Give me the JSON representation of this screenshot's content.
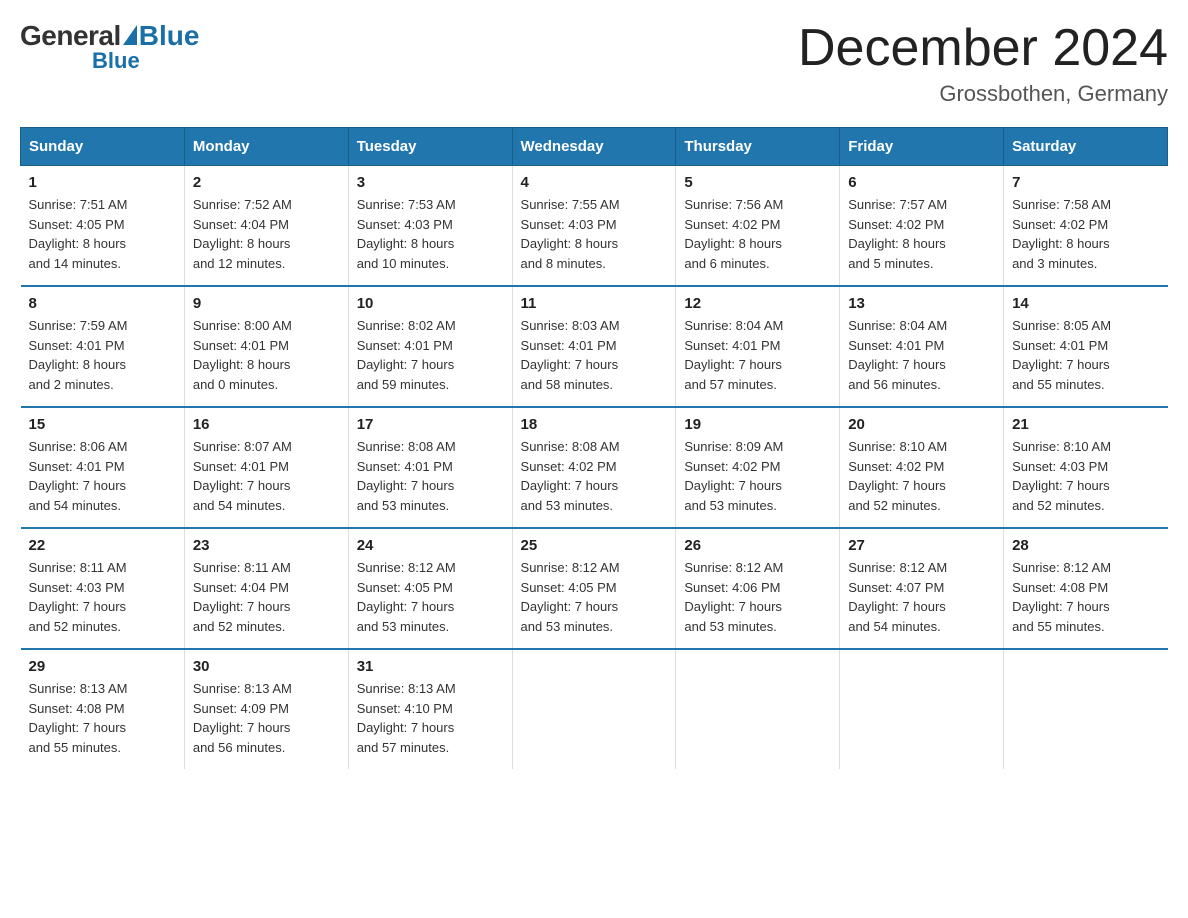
{
  "header": {
    "logo_general": "General",
    "logo_blue": "Blue",
    "month_title": "December 2024",
    "location": "Grossbothen, Germany"
  },
  "days_of_week": [
    "Sunday",
    "Monday",
    "Tuesday",
    "Wednesday",
    "Thursday",
    "Friday",
    "Saturday"
  ],
  "weeks": [
    [
      {
        "day": "1",
        "sunrise": "7:51 AM",
        "sunset": "4:05 PM",
        "daylight": "8 hours and 14 minutes."
      },
      {
        "day": "2",
        "sunrise": "7:52 AM",
        "sunset": "4:04 PM",
        "daylight": "8 hours and 12 minutes."
      },
      {
        "day": "3",
        "sunrise": "7:53 AM",
        "sunset": "4:03 PM",
        "daylight": "8 hours and 10 minutes."
      },
      {
        "day": "4",
        "sunrise": "7:55 AM",
        "sunset": "4:03 PM",
        "daylight": "8 hours and 8 minutes."
      },
      {
        "day": "5",
        "sunrise": "7:56 AM",
        "sunset": "4:02 PM",
        "daylight": "8 hours and 6 minutes."
      },
      {
        "day": "6",
        "sunrise": "7:57 AM",
        "sunset": "4:02 PM",
        "daylight": "8 hours and 5 minutes."
      },
      {
        "day": "7",
        "sunrise": "7:58 AM",
        "sunset": "4:02 PM",
        "daylight": "8 hours and 3 minutes."
      }
    ],
    [
      {
        "day": "8",
        "sunrise": "7:59 AM",
        "sunset": "4:01 PM",
        "daylight": "8 hours and 2 minutes."
      },
      {
        "day": "9",
        "sunrise": "8:00 AM",
        "sunset": "4:01 PM",
        "daylight": "8 hours and 0 minutes."
      },
      {
        "day": "10",
        "sunrise": "8:02 AM",
        "sunset": "4:01 PM",
        "daylight": "7 hours and 59 minutes."
      },
      {
        "day": "11",
        "sunrise": "8:03 AM",
        "sunset": "4:01 PM",
        "daylight": "7 hours and 58 minutes."
      },
      {
        "day": "12",
        "sunrise": "8:04 AM",
        "sunset": "4:01 PM",
        "daylight": "7 hours and 57 minutes."
      },
      {
        "day": "13",
        "sunrise": "8:04 AM",
        "sunset": "4:01 PM",
        "daylight": "7 hours and 56 minutes."
      },
      {
        "day": "14",
        "sunrise": "8:05 AM",
        "sunset": "4:01 PM",
        "daylight": "7 hours and 55 minutes."
      }
    ],
    [
      {
        "day": "15",
        "sunrise": "8:06 AM",
        "sunset": "4:01 PM",
        "daylight": "7 hours and 54 minutes."
      },
      {
        "day": "16",
        "sunrise": "8:07 AM",
        "sunset": "4:01 PM",
        "daylight": "7 hours and 54 minutes."
      },
      {
        "day": "17",
        "sunrise": "8:08 AM",
        "sunset": "4:01 PM",
        "daylight": "7 hours and 53 minutes."
      },
      {
        "day": "18",
        "sunrise": "8:08 AM",
        "sunset": "4:02 PM",
        "daylight": "7 hours and 53 minutes."
      },
      {
        "day": "19",
        "sunrise": "8:09 AM",
        "sunset": "4:02 PM",
        "daylight": "7 hours and 53 minutes."
      },
      {
        "day": "20",
        "sunrise": "8:10 AM",
        "sunset": "4:02 PM",
        "daylight": "7 hours and 52 minutes."
      },
      {
        "day": "21",
        "sunrise": "8:10 AM",
        "sunset": "4:03 PM",
        "daylight": "7 hours and 52 minutes."
      }
    ],
    [
      {
        "day": "22",
        "sunrise": "8:11 AM",
        "sunset": "4:03 PM",
        "daylight": "7 hours and 52 minutes."
      },
      {
        "day": "23",
        "sunrise": "8:11 AM",
        "sunset": "4:04 PM",
        "daylight": "7 hours and 52 minutes."
      },
      {
        "day": "24",
        "sunrise": "8:12 AM",
        "sunset": "4:05 PM",
        "daylight": "7 hours and 53 minutes."
      },
      {
        "day": "25",
        "sunrise": "8:12 AM",
        "sunset": "4:05 PM",
        "daylight": "7 hours and 53 minutes."
      },
      {
        "day": "26",
        "sunrise": "8:12 AM",
        "sunset": "4:06 PM",
        "daylight": "7 hours and 53 minutes."
      },
      {
        "day": "27",
        "sunrise": "8:12 AM",
        "sunset": "4:07 PM",
        "daylight": "7 hours and 54 minutes."
      },
      {
        "day": "28",
        "sunrise": "8:12 AM",
        "sunset": "4:08 PM",
        "daylight": "7 hours and 55 minutes."
      }
    ],
    [
      {
        "day": "29",
        "sunrise": "8:13 AM",
        "sunset": "4:08 PM",
        "daylight": "7 hours and 55 minutes."
      },
      {
        "day": "30",
        "sunrise": "8:13 AM",
        "sunset": "4:09 PM",
        "daylight": "7 hours and 56 minutes."
      },
      {
        "day": "31",
        "sunrise": "8:13 AM",
        "sunset": "4:10 PM",
        "daylight": "7 hours and 57 minutes."
      },
      null,
      null,
      null,
      null
    ]
  ],
  "labels": {
    "sunrise": "Sunrise:",
    "sunset": "Sunset:",
    "daylight": "Daylight:"
  }
}
